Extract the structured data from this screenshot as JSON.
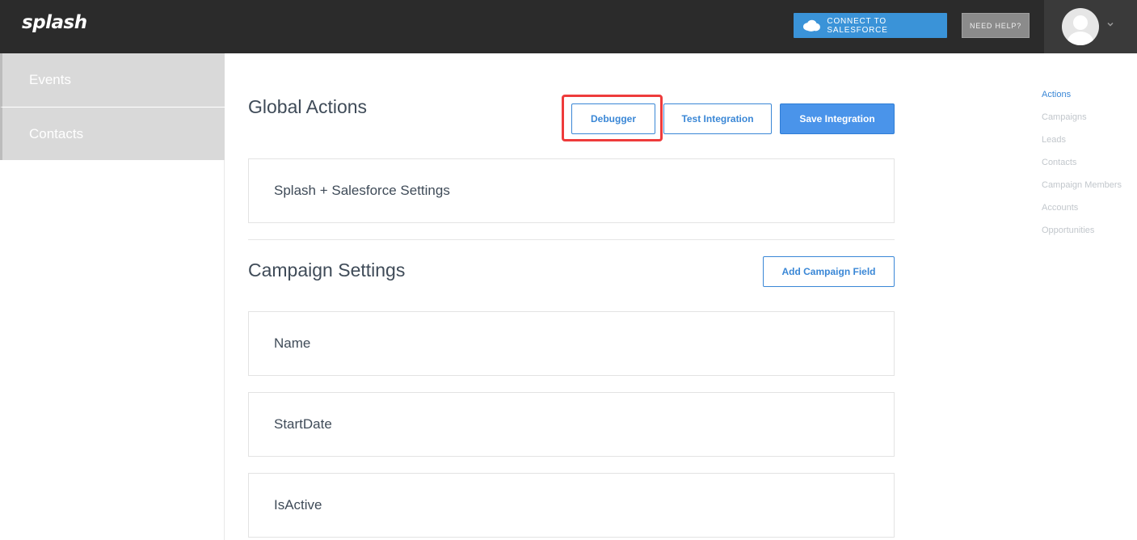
{
  "header": {
    "logo": "splash",
    "salesforce_button": "CONNECT TO SALESFORCE",
    "help_button": "NEED HELP?"
  },
  "sidebar": {
    "items": [
      {
        "label": "Events"
      },
      {
        "label": "Contacts"
      }
    ]
  },
  "global_actions": {
    "title": "Global Actions",
    "debugger_button": "Debugger",
    "test_button": "Test Integration",
    "save_button": "Save Integration",
    "settings_card": "Splash + Salesforce Settings"
  },
  "campaign_settings": {
    "title": "Campaign Settings",
    "add_field_button": "Add Campaign Field",
    "fields": [
      "Name",
      "StartDate",
      "IsActive"
    ]
  },
  "right_nav": {
    "items": [
      "Actions",
      "Campaigns",
      "Leads",
      "Contacts",
      "Campaign Members",
      "Accounts",
      "Opportunities"
    ],
    "active": "Actions"
  },
  "colors": {
    "topbar": "#2b2b2b",
    "accent": "#3a87d6",
    "primary_button": "#4a94ea",
    "salesforce_button": "#3a93d8",
    "highlight": "#ee3b3b"
  },
  "icons": {
    "salesforce": "salesforce-cloud-icon",
    "avatar": "user-avatar-icon",
    "dropdown": "chevron-down-icon"
  }
}
